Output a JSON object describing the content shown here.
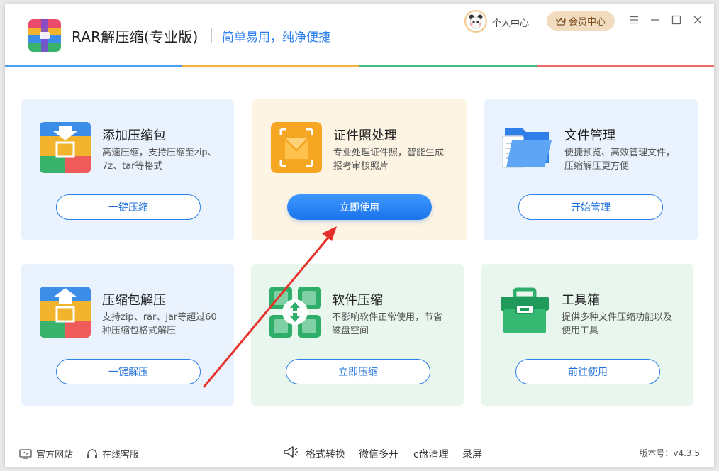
{
  "header": {
    "app_title": "RAR解压缩(专业版)",
    "slogan": "简单易用，纯净便捷",
    "user_center": "个人中心",
    "vip_center": "会员中心"
  },
  "colors": {
    "accent": "#2c7ff0",
    "bar": [
      "#4a9ef2",
      "#f3b23a",
      "#3fbf7f",
      "#ef6a6a"
    ]
  },
  "cards": [
    {
      "title": "添加压缩包",
      "desc": "高速压缩，支持压缩至zip、7z、tar等格式",
      "button": "一键压缩",
      "icon": "compress-icon"
    },
    {
      "title": "证件照处理",
      "desc": "专业处理证件照，智能生成报考审核照片",
      "button": "立即使用",
      "icon": "id-photo-icon"
    },
    {
      "title": "文件管理",
      "desc": "便捷预览、高效管理文件，压缩解压更方便",
      "button": "开始管理",
      "icon": "folder-icon"
    },
    {
      "title": "压缩包解压",
      "desc": "支持zip、rar、jar等超过60种压缩包格式解压",
      "button": "一键解压",
      "icon": "extract-icon"
    },
    {
      "title": "软件压缩",
      "desc": "不影响软件正常使用，节省磁盘空间",
      "button": "立即压缩",
      "icon": "software-compress-icon"
    },
    {
      "title": "工具箱",
      "desc": "提供多种文件压缩功能以及使用工具",
      "button": "前往使用",
      "icon": "toolbox-icon"
    }
  ],
  "footer": {
    "official_site": "官方网站",
    "online_service": "在线客服",
    "links": [
      "格式转换",
      "微信多开",
      "c盘清理",
      "录屏"
    ],
    "version": "版本号：v4.3.5"
  }
}
